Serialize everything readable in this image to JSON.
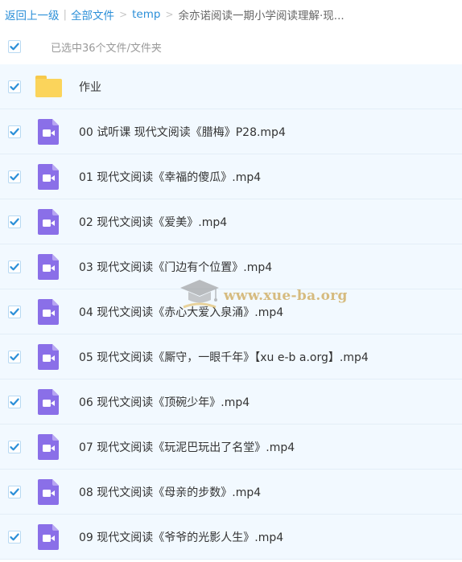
{
  "breadcrumb": {
    "back": "返回上一级",
    "all_files": "全部文件",
    "folder": "temp",
    "current": "余亦诺阅读一期小学阅读理解·现..."
  },
  "selection": {
    "summary": "已选中36个文件/文件夹"
  },
  "files": [
    {
      "name": "作业",
      "type": "folder"
    },
    {
      "name": "00 试听课 现代文阅读《腊梅》P28.mp4",
      "type": "video"
    },
    {
      "name": "01 现代文阅读《幸福的傻瓜》.mp4",
      "type": "video"
    },
    {
      "name": "02 现代文阅读《爱美》.mp4",
      "type": "video"
    },
    {
      "name": "03 现代文阅读《门边有个位置》.mp4",
      "type": "video"
    },
    {
      "name": "04 现代文阅读《赤心大爱入泉涌》.mp4",
      "type": "video"
    },
    {
      "name": "05 现代文阅读《厮守，一眼千年》【xu e-b a.org】.mp4",
      "type": "video"
    },
    {
      "name": "06 现代文阅读《顶碗少年》.mp4",
      "type": "video"
    },
    {
      "name": "07 现代文阅读《玩泥巴玩出了名堂》.mp4",
      "type": "video"
    },
    {
      "name": "08 现代文阅读《母亲的步数》.mp4",
      "type": "video"
    },
    {
      "name": "09 现代文阅读《爷爷的光影人生》.mp4",
      "type": "video"
    }
  ],
  "watermark": {
    "text": "www.xue-ba.org"
  },
  "colors": {
    "link": "#2b8fd8",
    "checkbox": "#2b8fd8",
    "row_bg": "#f2f9ff",
    "video_icon": "#8a6fe8",
    "folder_icon": "#fbd45b"
  }
}
